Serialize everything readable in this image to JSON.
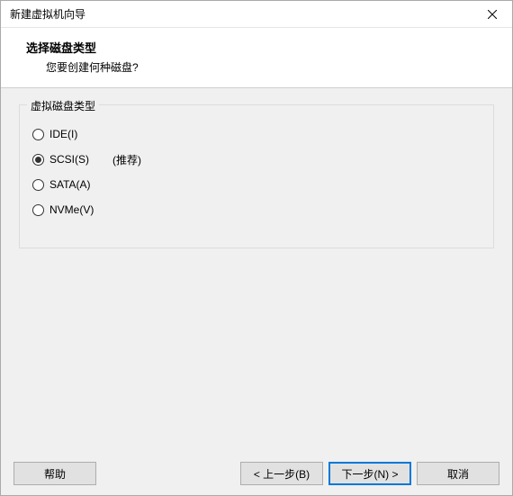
{
  "window": {
    "title": "新建虚拟机向导"
  },
  "header": {
    "title": "选择磁盘类型",
    "subtitle": "您要创建何种磁盘?"
  },
  "group": {
    "label": "虚拟磁盘类型",
    "options": [
      {
        "label": "IDE(I)",
        "checked": false,
        "hint": ""
      },
      {
        "label": "SCSI(S)",
        "checked": true,
        "hint": "(推荐)"
      },
      {
        "label": "SATA(A)",
        "checked": false,
        "hint": ""
      },
      {
        "label": "NVMe(V)",
        "checked": false,
        "hint": ""
      }
    ]
  },
  "footer": {
    "help": "帮助",
    "back": "< 上一步(B)",
    "next": "下一步(N) >",
    "cancel": "取消"
  }
}
